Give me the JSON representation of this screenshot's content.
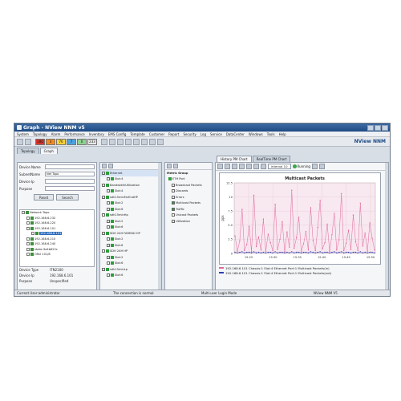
{
  "window": {
    "title": "Graph - NView NNM v5"
  },
  "menu": [
    "System",
    "Topology",
    "Alarm",
    "Performance",
    "Inventory",
    "EMS Config",
    "Template",
    "Customer",
    "Report",
    "Security",
    "Log",
    "Service",
    "DataCenter",
    "Windows",
    "Tools",
    "Help"
  ],
  "toolbar": {
    "severity_counts": [
      {
        "value": "180",
        "color": "#d9342b"
      },
      {
        "value": "3",
        "color": "#f08a24"
      },
      {
        "value": "76",
        "color": "#f5d23a"
      },
      {
        "value": "7",
        "color": "#4aa3df"
      },
      {
        "value": "0",
        "color": "#8fd18f"
      },
      {
        "value": "233",
        "color": "#e8e8e8"
      }
    ],
    "brand": "NView NNM"
  },
  "tabs": [
    {
      "label": "Topology"
    },
    {
      "label": "Graph"
    }
  ],
  "left": {
    "fields": [
      {
        "label": "Device Name",
        "value": ""
      },
      {
        "label": "SubnetName",
        "value": "Net Topo"
      },
      {
        "label": "Device Ip",
        "value": ""
      },
      {
        "label": "Purpose",
        "value": ""
      }
    ],
    "reset_label": "Reset",
    "search_label": "Search",
    "tree": [
      {
        "label": "Network Topo",
        "indent": 0
      },
      {
        "label": "192.168.6.232",
        "indent": 1
      },
      {
        "label": "192.168.6.220",
        "indent": 1
      },
      {
        "label": "192.168.6.101",
        "indent": 1
      },
      {
        "label": "192.168.6.101",
        "indent": 2,
        "selected": true
      },
      {
        "label": "192.168.6.210",
        "indent": 1
      },
      {
        "label": "192.168.6.240",
        "indent": 1
      },
      {
        "label": "stake-9a4b622c",
        "indent": 1
      },
      {
        "label": "ONU 101/8",
        "indent": 1
      }
    ],
    "props": [
      {
        "k": "Device Type",
        "v": "ITN2100"
      },
      {
        "k": "Device Ip",
        "v": "192.168.6.101"
      },
      {
        "k": "Purpose",
        "v": "Unspecified"
      }
    ]
  },
  "mid1": {
    "items": [
      {
        "label": "Ethernet",
        "indent": 0,
        "sel": true
      },
      {
        "label": "Slot:4",
        "indent": 1
      },
      {
        "label": "BandwidthUtilization",
        "indent": 0
      },
      {
        "label": "Slot:4",
        "indent": 1
      },
      {
        "label": "sdh15minFarEndHP",
        "indent": 0
      },
      {
        "label": "Slot:2",
        "indent": 1
      },
      {
        "label": "Slot:6",
        "indent": 1
      },
      {
        "label": "sdh15minHp",
        "indent": 0
      },
      {
        "label": "Slot:2",
        "indent": 1
      },
      {
        "label": "Slot:6",
        "indent": 1
      },
      {
        "label": "SDH 24H FAREND HP",
        "indent": 0
      },
      {
        "label": "Slot:2",
        "indent": 1
      },
      {
        "label": "Slot:6",
        "indent": 1
      },
      {
        "label": "SDH 24H HP",
        "indent": 0
      },
      {
        "label": "Slot:2",
        "indent": 1
      },
      {
        "label": "Slot:6",
        "indent": 1
      },
      {
        "label": "sdh15minLp",
        "indent": 0
      },
      {
        "label": "Slot:6",
        "indent": 1
      }
    ]
  },
  "mid2": {
    "items": [
      {
        "label": "Metric Group",
        "type": "head"
      },
      {
        "label": "ETH Port",
        "type": "group"
      },
      {
        "label": "Broadcast Packets",
        "type": "off"
      },
      {
        "label": "Discards",
        "type": "off"
      },
      {
        "label": "Errors",
        "type": "off"
      },
      {
        "label": "Multicast Packets",
        "type": "on"
      },
      {
        "label": "Traffic",
        "type": "on"
      },
      {
        "label": "Unicast Packets",
        "type": "off"
      },
      {
        "label": "Utilization",
        "type": "off"
      }
    ]
  },
  "chart_tabs": [
    {
      "label": "History PM Chart"
    },
    {
      "label": "RealTime PM Chart"
    }
  ],
  "controls": {
    "interval": "interval 10",
    "running": "Running"
  },
  "chart_data": {
    "type": "line",
    "title": "Multicast Packets",
    "ylabel": "pps",
    "ylim": [
      0,
      12.5
    ],
    "yticks": [
      "0",
      "2.5",
      "5.0",
      "7.5",
      "10",
      "12.5"
    ],
    "xticks": [
      "15:25",
      "15:30",
      "15:35",
      "15:40",
      "15:45",
      "15:50"
    ],
    "series": [
      {
        "name": "192.168.6.101 Chassis:1 Slot:4 Ethernet Port:1 Multicast Packets(in)",
        "color": "#e0679a",
        "values": [
          3.1,
          0.4,
          2.2,
          7.8,
          0.5,
          1.6,
          4.8,
          0.3,
          10.3,
          1.2,
          2.9,
          0.6,
          6.1,
          0.4,
          3.4,
          1.9,
          0.5,
          8.7,
          0.7,
          2.5,
          5.6,
          0.3,
          3.8,
          1.1,
          11.2,
          0.9,
          2.8,
          6.4,
          0.4,
          1.7,
          3.9,
          0.6,
          8.1,
          2.3,
          0.5,
          4.6,
          9.4,
          0.8,
          1.9,
          5.2,
          0.4,
          3.3,
          7.1,
          0.6,
          2.4,
          10.6,
          0.5,
          1.8,
          4.1,
          0.7,
          6.8,
          2.1,
          0.5,
          8.9,
          1.3,
          3.6,
          0.4,
          5.4,
          2.7,
          0.6
        ]
      },
      {
        "name": "192.168.6.101 Chassis:1 Slot:4 Ethernet Port:1 Multicast Packets(out)",
        "color": "#2b3fb0",
        "values": [
          0.2,
          0.1,
          0.2,
          0.3,
          0.1,
          0.2,
          0.2,
          0.1,
          0.3,
          0.1,
          0.2,
          0.1,
          0.2,
          0.1,
          0.2,
          0.2,
          0.1,
          0.3,
          0.1,
          0.2,
          0.2,
          0.1,
          0.2,
          0.1,
          0.3,
          0.1,
          0.2,
          0.2,
          0.1,
          0.2,
          0.2,
          0.1,
          0.3,
          0.2,
          0.1,
          0.2,
          0.3,
          0.1,
          0.2,
          0.2,
          0.1,
          0.2,
          0.3,
          0.1,
          0.2,
          0.3,
          0.1,
          0.2,
          0.2,
          0.1,
          0.2,
          0.2,
          0.1,
          0.3,
          0.1,
          0.2,
          0.1,
          0.2,
          0.2,
          0.1
        ]
      }
    ]
  },
  "status": {
    "user": "Current User:administrator",
    "connection": "The connection is normal",
    "mode": "Multi-user Login Mode",
    "version": "NView NNM V5"
  }
}
